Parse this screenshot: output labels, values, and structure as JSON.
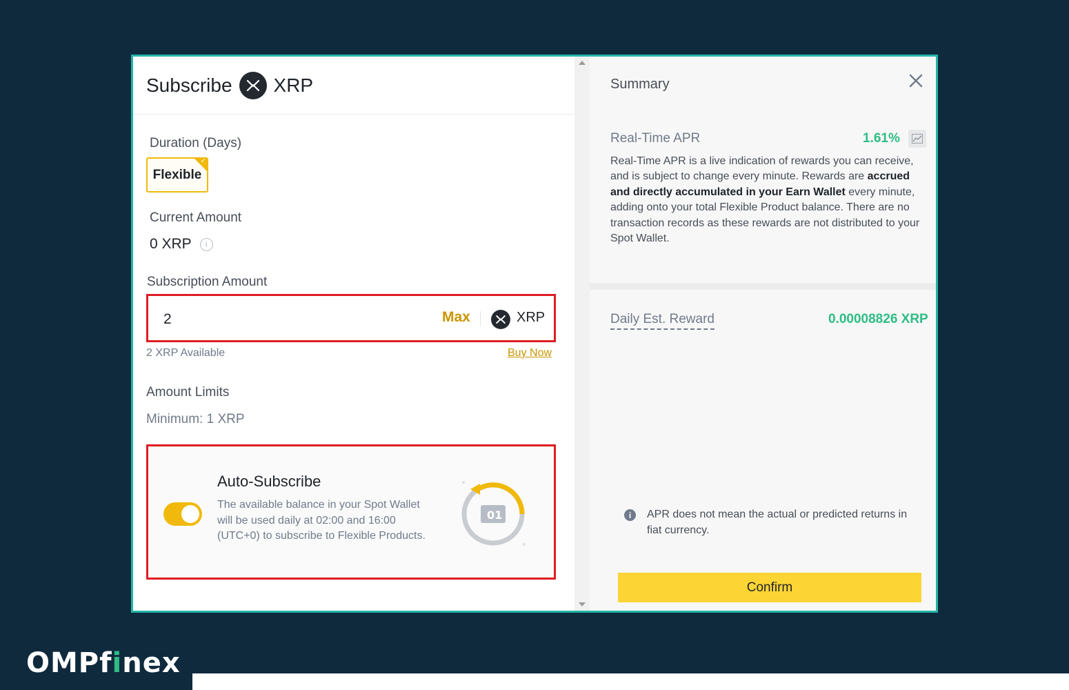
{
  "subscribe": {
    "title": "Subscribe",
    "coin": "XRP",
    "duration_label": "Duration (Days)",
    "duration_option": "Flexible",
    "current_amount_label": "Current Amount",
    "current_amount_value": "0 XRP",
    "subscription_amount_label": "Subscription Amount",
    "amount_input_value": "2",
    "max_label": "Max",
    "unit": "XRP",
    "available": "2 XRP Available",
    "buy_now": "Buy Now",
    "amount_limits_label": "Amount Limits",
    "minimum": "Minimum: 1 XRP",
    "auto_subscribe_title": "Auto-Subscribe",
    "auto_subscribe_desc": "The available balance in your Spot Wallet will be used daily at 02:00 and 16:00 (UTC+0) to subscribe to Flexible Products.",
    "auto_subscribe_enabled": true
  },
  "summary": {
    "title": "Summary",
    "apr_label": "Real-Time APR",
    "apr_value": "1.61%",
    "apr_desc_1": "Real-Time APR is a live indication of rewards you can receive, and is subject to change every minute. Rewards are ",
    "apr_desc_bold": "accrued and directly accumulated in your Earn Wallet",
    "apr_desc_2": " every minute, adding onto your total Flexible Product balance. There are no transaction records as these rewards are not distributed to your Spot Wallet.",
    "daily_label": "Daily Est. Reward",
    "daily_value": "0.00008826 XRP",
    "note": "APR does not mean the actual or predicted returns in fiat currency.",
    "confirm": "Confirm"
  },
  "brand": {
    "part1": "OMPf",
    "part2": "i",
    "part3": "nex"
  },
  "colors": {
    "accent_yellow": "#fcd535",
    "positive_green": "#2ebd85",
    "highlight_red": "#e01c24",
    "frame_teal": "#23b5a8",
    "background": "#0f2a3d"
  }
}
